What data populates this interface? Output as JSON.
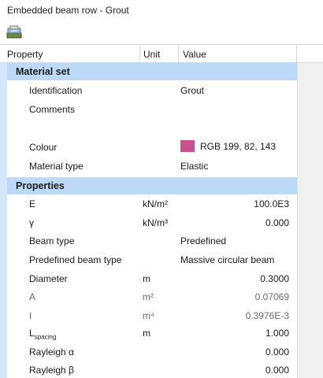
{
  "window": {
    "title": "Embedded beam row - Grout"
  },
  "toolbar": {
    "icon": "material-database-icon"
  },
  "columns": {
    "property": "Property",
    "unit": "Unit",
    "value": "Value"
  },
  "sections": {
    "material_set": "Material set",
    "properties": "Properties"
  },
  "material_set": {
    "identification": {
      "label": "Identification",
      "value": "Grout"
    },
    "comments": {
      "label": "Comments",
      "value": ""
    },
    "colour": {
      "label": "Colour",
      "value": "RGB 199, 82, 143",
      "swatch": "#c7528f"
    },
    "material_type": {
      "label": "Material type",
      "value": "Elastic"
    }
  },
  "properties": {
    "E": {
      "label": "E",
      "unit": "kN/m²",
      "value": "100.0E3"
    },
    "gamma": {
      "label": "γ",
      "unit": "kN/m³",
      "value": "0.000"
    },
    "beam_type": {
      "label": "Beam type",
      "value": "Predefined"
    },
    "predefined_beam_type": {
      "label": "Predefined beam type",
      "value": "Massive circular beam"
    },
    "diameter": {
      "label": "Diameter",
      "unit": "m",
      "value": "0.3000"
    },
    "A": {
      "label": "A",
      "unit": "m²",
      "value": "0.07069"
    },
    "I": {
      "label": "I",
      "unit": "m⁴",
      "value": "0.3976E-3"
    },
    "L_spacing": {
      "label": "L",
      "sub": "spacing",
      "unit": "m",
      "value": "1.000"
    },
    "rayleigh_alpha": {
      "label": "Rayleigh α",
      "value": "0.000"
    },
    "rayleigh_beta": {
      "label": "Rayleigh β",
      "value": "0.000"
    }
  }
}
